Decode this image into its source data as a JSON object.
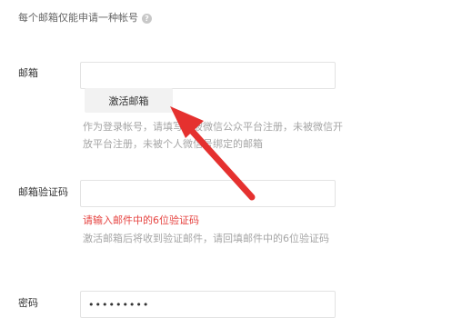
{
  "top_note": {
    "text": "每个邮箱仅能申请一种帐号",
    "help_icon": "question-circle-icon"
  },
  "email": {
    "label": "邮箱",
    "value": "",
    "activate_button": "激活邮箱",
    "hint": "作为登录帐号，请填写未被微信公众平台注册，未被微信开放平台注册，未被个人微信号绑定的邮箱"
  },
  "verify": {
    "label": "邮箱验证码",
    "value": "",
    "error": "请输入邮件中的6位验证码",
    "hint": "激活邮箱后将收到验证邮件，请回填邮件中的6位验证码"
  },
  "password": {
    "label": "密码",
    "value": "•••••••••"
  },
  "annotation": {
    "arrow_color": "#e5312f"
  }
}
